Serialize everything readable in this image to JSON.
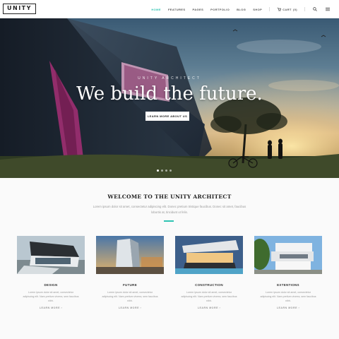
{
  "header": {
    "logo": "UNITY",
    "menu": [
      {
        "label": "HOME",
        "active": true
      },
      {
        "label": "FEATURES",
        "active": false
      },
      {
        "label": "PAGES",
        "active": false
      },
      {
        "label": "PORTFOLIO",
        "active": false
      },
      {
        "label": "BLOG",
        "active": false
      },
      {
        "label": "SHOP",
        "active": false
      }
    ],
    "cart_label": "CART",
    "cart_count": "(0)",
    "icons": [
      "cart-icon",
      "search-icon",
      "menu-icon"
    ]
  },
  "hero": {
    "kicker": "UNITY ARCHITECT",
    "title": "We build the future.",
    "button_label": "LEARN MORE ABOUT US",
    "slide_count": 4,
    "active_slide": 1
  },
  "welcome": {
    "title": "WELCOME TO THE UNITY ARCHITECT",
    "text": "Lorem ipsum dolor sit amet, consectetur adipiscing elit. Donec pretium tristique faucibus. Donec sit amet, faucibus lobortis at, tincidunt ut felis."
  },
  "cards": [
    {
      "title": "DESIGN",
      "text": "Lorem ipsum dolor sit amet, consectetur adipiscing elit. Nam pretium viverra, sem faucibus nibh.",
      "link": "LEARN MORE ›"
    },
    {
      "title": "FUTURE",
      "text": "Lorem ipsum dolor sit amet, consectetur adipiscing elit. Nam pretium viverra, sem faucibus nibh.",
      "link": "LEARN MORE ›"
    },
    {
      "title": "CONSTRUCTION",
      "text": "Lorem ipsum dolor sit amet, consectetur adipiscing elit. Nam pretium viverra, sem faucibus nibh.",
      "link": "LEARN MORE ›"
    },
    {
      "title": "EXTENTIONS",
      "text": "Lorem ipsum dolor sit amet, consectetur adipiscing elit. Nam pretium viverra, sem faucibus nibh.",
      "link": "LEARN MORE ›"
    }
  ],
  "colors": {
    "accent": "#2fc4b2"
  }
}
